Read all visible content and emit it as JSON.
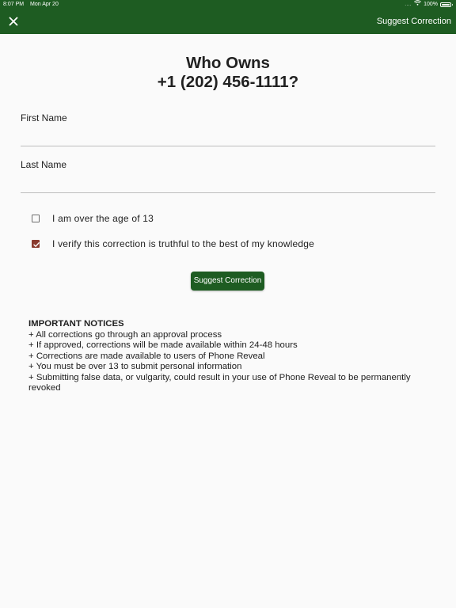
{
  "status_bar": {
    "time": "8:07 PM",
    "date": "Mon Apr 20",
    "signal": "....",
    "battery": "100%"
  },
  "navbar": {
    "close_icon": "close-icon",
    "action_label": "Suggest Correction"
  },
  "title": {
    "line1": "Who Owns",
    "line2": "+1 (202) 456-1111?"
  },
  "form": {
    "first_name_label": "First Name",
    "first_name_value": "",
    "last_name_label": "Last Name",
    "last_name_value": "",
    "age_check_label": "I am over the age of 13",
    "age_checked": false,
    "verify_check_label": "I verify this correction is truthful to the best of my knowledge",
    "verify_checked": true,
    "submit_label": "Suggest Correction"
  },
  "notices": {
    "heading": "IMPORTANT NOTICES",
    "items": [
      "+ All corrections go through an approval process",
      "+ If approved, corrections will be made available within 24-48 hours",
      "+ Corrections are made available to users of Phone Reveal",
      "+ You must be over 13 to submit personal information",
      "+ Submitting false data, or vulgarity, could result in your use of Phone Reveal to be permanently revoked"
    ]
  },
  "colors": {
    "brand_green": "#1e5c22",
    "checkbox_checked": "#8a3a2e",
    "background": "#fafafa"
  }
}
